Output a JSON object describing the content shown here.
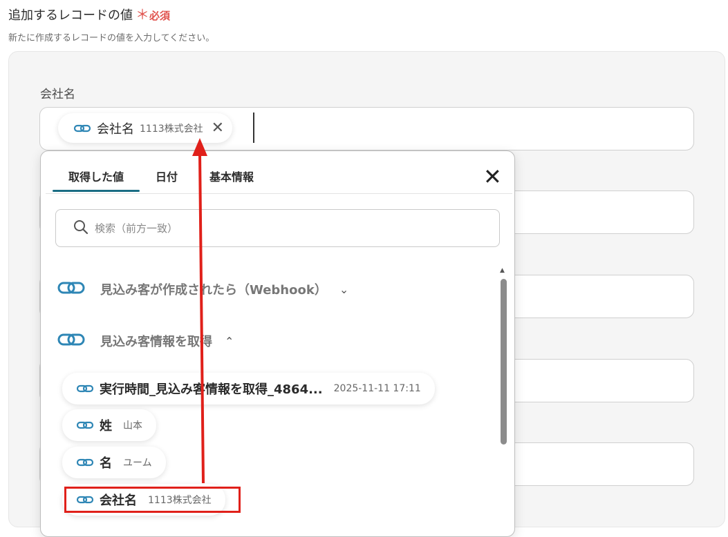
{
  "section": {
    "title": "追加するレコードの値",
    "required_mark": "＊",
    "required_text": "必須",
    "description": "新たに作成するレコードの値を入力してください。"
  },
  "field": {
    "label": "会社名",
    "chip_label": "会社名",
    "chip_value": "1113株式会社"
  },
  "dropdown": {
    "tabs": [
      "取得した値",
      "日付",
      "基本情報"
    ],
    "active_tab": 0,
    "search_placeholder": "検索（前方一致）",
    "groups": [
      {
        "label": "見込み客が作成されたら（Webhook）",
        "expanded": false
      },
      {
        "label": "見込み客情報を取得",
        "expanded": true
      }
    ],
    "items": [
      {
        "label": "実行時間_見込み客情報を取得_4864...",
        "value": "2025-11-11 17:11"
      },
      {
        "label": "姓",
        "value": "山本"
      },
      {
        "label": "名",
        "value": "ユーム"
      },
      {
        "label": "会社名",
        "value": "1113株式会社"
      }
    ]
  },
  "colors": {
    "accent": "#1a6d84",
    "required": "#e0524d",
    "annotation": "#e0201a",
    "link_icon": "#2e86b5"
  }
}
